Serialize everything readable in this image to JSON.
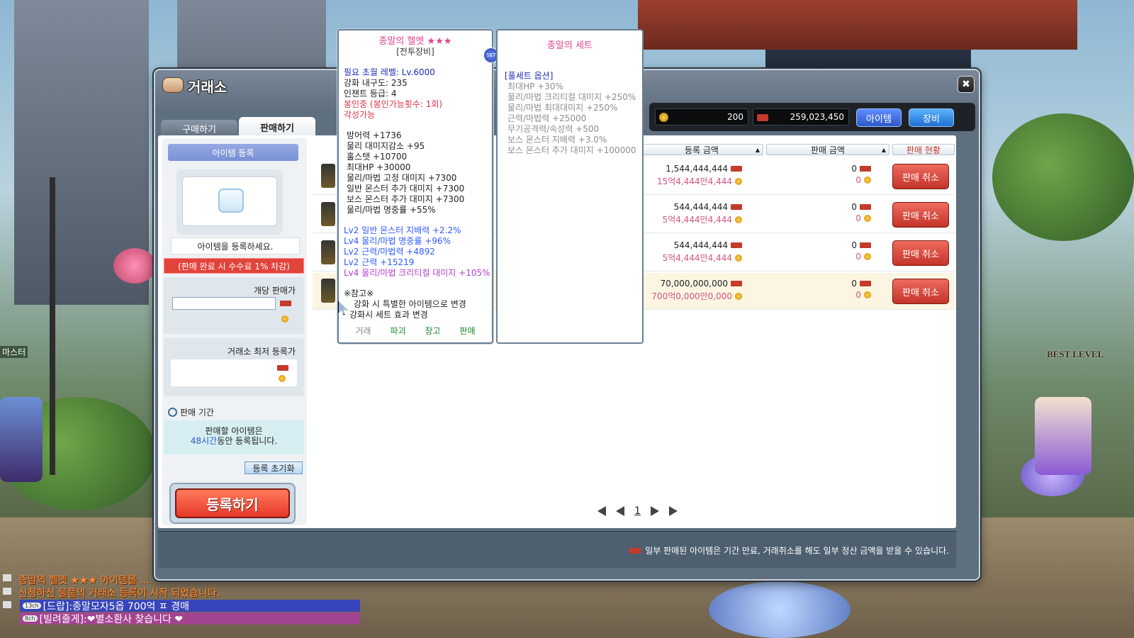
{
  "window": {
    "title": "거래소",
    "close_label": "✖"
  },
  "tabs": {
    "buy": "구매하기",
    "sell": "판매하기"
  },
  "currency": {
    "maple_points": "200",
    "meso": "259,023,450"
  },
  "category_buttons": {
    "item": "아이템",
    "equip": "장비"
  },
  "left_panel": {
    "header": "아이템 등록",
    "register_prompt": "아이템을 등록하세요.",
    "fee_notice": "(판매 완료 시 수수료 1% 차감)",
    "unit_price_label": "개당 판매가",
    "lowest_price_label": "거래소 최저 등록가",
    "period_label": "판매 기간",
    "period_line1": "판매할 아이템은",
    "period_hours": "48시간",
    "period_line2_rest": "동안 등록됩니다.",
    "reset_button": "등록 초기화",
    "register_button": "등록하기"
  },
  "table": {
    "headers": {
      "registered_price": "등록 금액",
      "sell_price": "판매 금액",
      "status": "판매 현황"
    },
    "rows": [
      {
        "price": "1,544,444,444",
        "price_sub": "15억4,444만4,444",
        "sold": "0",
        "sold_sub": "0",
        "action": "판매 취소"
      },
      {
        "price": "544,444,444",
        "price_sub": "5억4,444만4,444",
        "sold": "0",
        "sold_sub": "0",
        "action": "판매 취소"
      },
      {
        "price": "544,444,444",
        "price_sub": "5억4,444만4,444",
        "sold": "0",
        "sold_sub": "0",
        "action": "판매 취소"
      },
      {
        "price": "70,000,000,000",
        "price_sub": "700억0,000만0,000",
        "sold": "0",
        "sold_sub": "0",
        "action": "판매 취소"
      }
    ]
  },
  "pager": {
    "current_page": "1"
  },
  "footer": {
    "notice": "일부 판매된 아이템은 기간 만료, 거래취소를 해도 일부 정산 금액을 받을 수 있습니다."
  },
  "tooltip": {
    "title": "종말의 헬멧 ★★★",
    "type": "[전투장비]",
    "set_badge": "SET",
    "lines_top": [
      "필요 초월 레벨: Lv.6000",
      "강화 내구도: 235",
      "인챈트 등급: 4",
      "봉인중 (봉인가능횟수: 1회)",
      "각성가능"
    ],
    "stats": [
      "방어력 +1736",
      "물리 대미지감소 +95",
      "홀스탯 +10700",
      "최대HP +30000",
      "물리/마법 고정 대미지 +7300",
      "일반 몬스터 추가 대미지 +7300",
      "보스 몬스터 추가 대미지 +7300",
      "물리/마법 명중률 +55%"
    ],
    "potentials": [
      "Lv2 일반 몬스터 지배력 +2.2%",
      "Lv4 물리/마법 명중률 +96%",
      "Lv2 근력/마법력 +4892",
      "Lv2 근력 +15219",
      "Lv4 물리/마법 크리티컬 대미지 +105%"
    ],
    "notes_title": "※참고※",
    "notes": [
      "강화 시 특별한 아이템으로 변경",
      "강화시 세트 효과 변경"
    ],
    "footer": [
      "거래",
      "파괴",
      "창고",
      "판매"
    ]
  },
  "set_tooltip": {
    "title": "종말의 세트",
    "option_header": "[풀세트 옵션]",
    "options": [
      "최대HP +30%",
      "물리/마법 크리티컬 대미지 +250%",
      "물리/마법 최대대미지 +250%",
      "근력/마법력 +25000",
      "무기공격력/속성력 +500",
      "보스 몬스터 지배력 +3.0%",
      "보스 몬스터 추가 대미지 +100000"
    ]
  },
  "chat": {
    "system1": "종말의 헬멧 ★★★ 아이템을 ...",
    "system2": "신청하신 물품의 거래소 등록이 시작 되었습니다.",
    "msg1_tag": "13ch",
    "msg1": "[드랍]:종말모자5옵 700억 ㅍ 경매",
    "msg2_tag": "8ch",
    "msg2": "[빌려줄게]:❤별소환사 찾습니다 ❤"
  },
  "scene": {
    "best_level": "BEST LEVEL",
    "left_npc": "마스터"
  }
}
